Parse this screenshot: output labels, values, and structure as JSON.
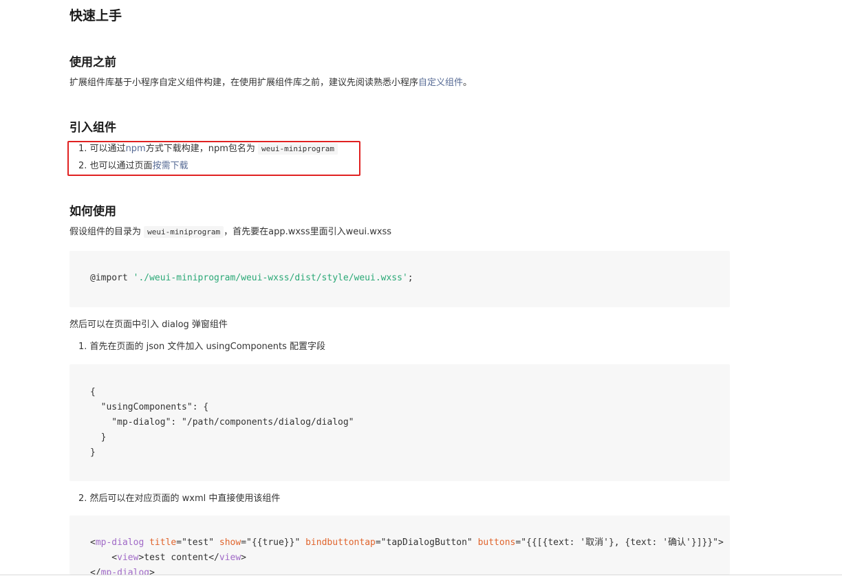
{
  "sections": {
    "quickstart_title": "快速上手",
    "before_title": "使用之前",
    "before_text_prefix": "扩展组件库基于小程序自定义组件构建，在使用扩展组件库之前，建议先阅读熟悉小程序",
    "before_link": "自定义组件",
    "before_text_suffix": "。",
    "import_title": "引入组件",
    "import_items": [
      {
        "num": "1.",
        "prefix": "可以通过",
        "link": "npm",
        "middle": "方式下载构建，npm包名为",
        "code": "weui-miniprogram"
      },
      {
        "num": "2.",
        "prefix": "也可以通过页面",
        "link": "按需下载"
      }
    ],
    "howto_title": "如何使用",
    "howto_text_prefix": "假设组件的目录为",
    "howto_code": "weui-miniprogram",
    "howto_text_suffix": "，首先要在app.wxss里面引入weui.wxss",
    "then_text": "然后可以在页面中引入 dialog 弹窗组件",
    "step1": "1. 首先在页面的 json 文件加入 usingComponents 配置字段",
    "step2": "2. 然后可以在对应页面的 wxml 中直接使用该组件"
  },
  "code": {
    "import_kw": "@import ",
    "import_path": "'./weui-miniprogram/weui-wxss/dist/style/weui.wxss'",
    "import_end": ";",
    "json_block": "{\n  \"usingComponents\": {\n    \"mp-dialog\": \"/path/components/dialog/dialog\"\n  }\n}",
    "wxml": {
      "open_lt": "<",
      "tag": "mp-dialog",
      "attr_title": "title",
      "val_title": "=\"test\" ",
      "attr_show": "show",
      "val_show": "=\"{{true}}\" ",
      "attr_bind": "bindbuttontap",
      "val_bind": "=\"tapDialogButton\" ",
      "attr_buttons": "buttons",
      "val_buttons": "=\"{{[{text: '取消'}, {text: '确认'}]}}\">",
      "inner_lt": "    <",
      "inner_tag": "view",
      "inner_text": ">test content</",
      "inner_tag_close": "view",
      "inner_gt": ">",
      "close_lt": "</",
      "close_tag": "mp-dialog",
      "close_gt": ">"
    }
  },
  "colors": {
    "link": "#576b95",
    "highlight": "#e02020",
    "code_bg": "#f7f7f7",
    "string": "#2aa876",
    "tag": "#a06ac7",
    "attr": "#e0642c"
  }
}
